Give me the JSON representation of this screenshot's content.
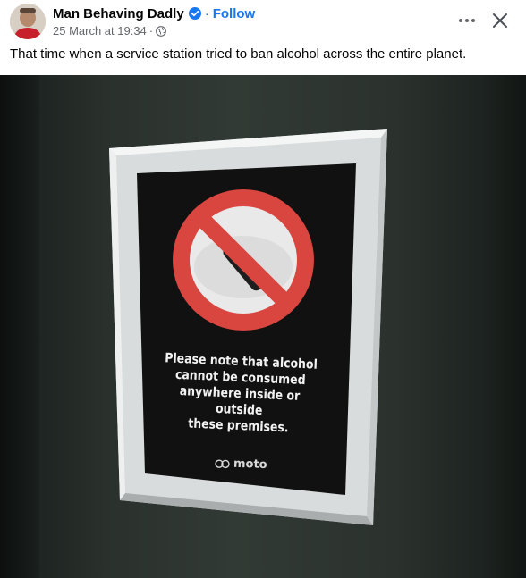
{
  "post": {
    "author": "Man Behaving Dadly",
    "separator": "·",
    "follow_label": "Follow",
    "timestamp": "25 March at 19:34",
    "meta_dot": "·",
    "caption": "That time when a service station tried to ban alcohol across the entire planet."
  },
  "sign": {
    "lines": [
      "Please note that alcohol",
      "cannot be consumed",
      "anywhere inside or outside",
      "these premises."
    ],
    "brand": "moto"
  },
  "icons": {
    "verified": "verified-badge-icon",
    "audience": "globe-icon",
    "more": "more-options-icon",
    "close": "close-icon"
  },
  "colors": {
    "link": "#1877f2",
    "meta": "#65676b",
    "prohibition_red": "#d9453f"
  }
}
